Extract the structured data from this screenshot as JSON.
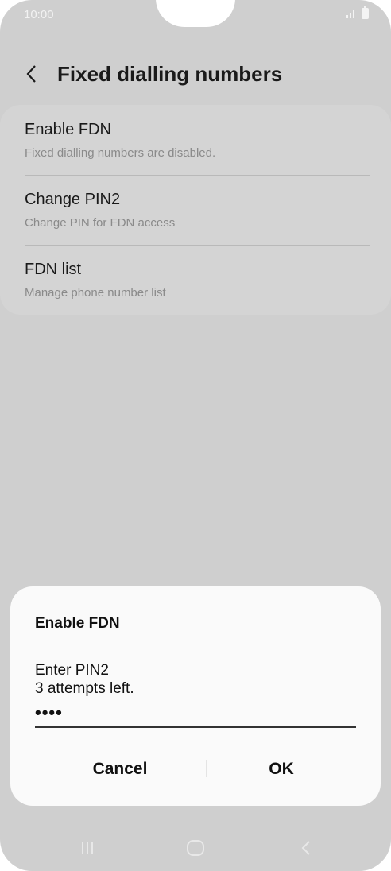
{
  "status_bar": {
    "time": "10:00"
  },
  "header": {
    "title": "Fixed dialling numbers"
  },
  "settings": {
    "items": [
      {
        "title": "Enable FDN",
        "subtitle": "Fixed dialling numbers are disabled."
      },
      {
        "title": "Change PIN2",
        "subtitle": "Change PIN for FDN access"
      },
      {
        "title": "FDN list",
        "subtitle": "Manage phone number list"
      }
    ]
  },
  "dialog": {
    "title": "Enable FDN",
    "message_line1": "Enter PIN2",
    "message_line2": "3 attempts left.",
    "pin_value": "••••",
    "cancel_label": "Cancel",
    "ok_label": "OK"
  },
  "navbar": {
    "icons": [
      "recent-apps-icon",
      "home-icon",
      "back-icon"
    ]
  },
  "colors": {
    "background_dimmed": "#cfcfcf",
    "dialog_background": "#fafafa",
    "text_primary": "#111111",
    "text_secondary": "#8a8a8a"
  }
}
